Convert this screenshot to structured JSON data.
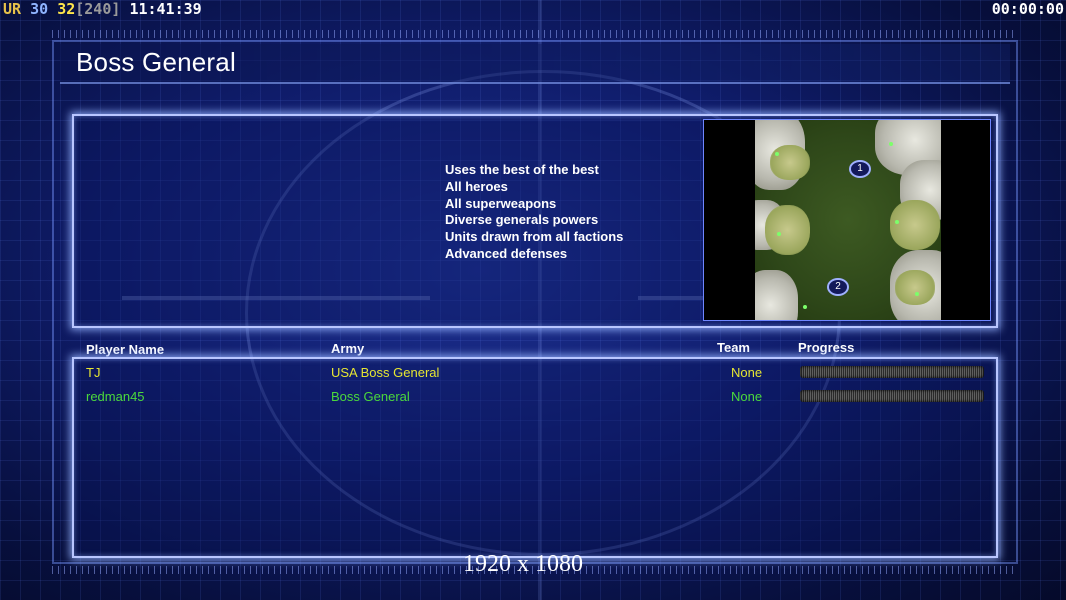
{
  "hud": {
    "left": {
      "ur": "UR",
      "fps": "30",
      "fps2": "32",
      "bracket": "[240]",
      "clock": "11:41:39"
    },
    "right_timer": "00:00:00"
  },
  "title": "Boss General",
  "description_lines": [
    "Uses the best of the best",
    "All heroes",
    "All superweapons",
    "Diverse generals powers",
    "Units drawn from all factions",
    "Advanced defenses"
  ],
  "map": {
    "markers": [
      "1",
      "2"
    ]
  },
  "columns": {
    "player": "Player Name",
    "army": "Army",
    "team": "Team",
    "progress": "Progress"
  },
  "players": [
    {
      "name": "TJ",
      "army": "USA Boss General",
      "team": "None",
      "color": "#e6e632",
      "progress": 0
    },
    {
      "name": "redman45",
      "army": "Boss General",
      "team": "None",
      "color": "#4bd93c",
      "progress": 0
    }
  ],
  "resolution": "1920 x 1080",
  "colors": {
    "hud_ur": "#e6c24a",
    "hud_fps": "#8fb4ff",
    "hud_fps2": "#ffe64a",
    "hud_bracket": "#9a9a9a"
  }
}
